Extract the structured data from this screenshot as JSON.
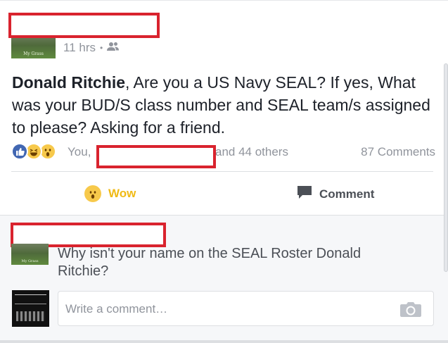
{
  "post": {
    "time": "11 hrs",
    "separator": "•",
    "author_mention": "Donald Ritchie",
    "body": ", Are you a US Navy SEAL? If yes, What was your BUD/S class number and SEAL team/s assigned to please? Asking for a friend.",
    "avatar_caption": "My Grass"
  },
  "reactions": {
    "you_label": "You,",
    "others_label": "and 44 others",
    "comment_count": "87 Comments"
  },
  "actions": {
    "wow_label": "Wow",
    "comment_label": "Comment"
  },
  "comment": {
    "avatar_caption": "My Grass",
    "text": "Why isn't your name on the SEAL Roster Donald Ritchie?"
  },
  "composer": {
    "placeholder": "Write a comment…"
  },
  "colors": {
    "redaction": "#d9232e",
    "like_blue": "#4267b2",
    "wow_yellow": "#f0ba15",
    "muted_text": "#90949c"
  },
  "icons": {
    "audience": "friends-icon",
    "like": "like-reaction-icon",
    "haha": "haha-reaction-icon",
    "wow": "wow-reaction-icon",
    "comment": "comment-icon",
    "camera": "camera-icon"
  }
}
